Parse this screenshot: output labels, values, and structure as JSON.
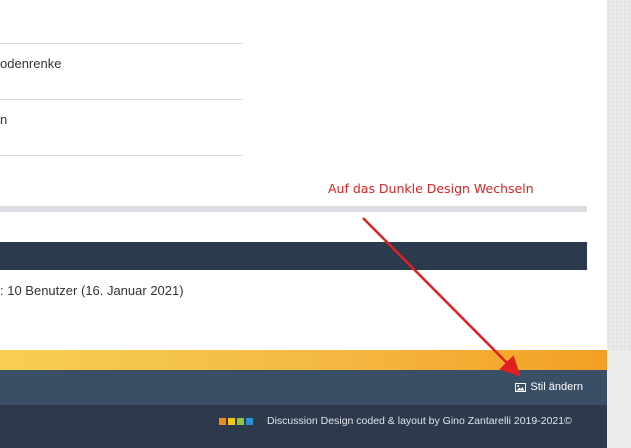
{
  "list": {
    "rows": [
      {
        "text": "odenrenke"
      },
      {
        "text": "n"
      }
    ]
  },
  "annotation": {
    "text": "Auf das Dunkle Design Wechseln",
    "color": "#e02020"
  },
  "stats": {
    "text": ": 10 Benutzer (16. Januar 2021)"
  },
  "style_bar": {
    "label": "Stil ändern",
    "icon": "image-icon"
  },
  "footer": {
    "credit": "Discussion Design coded & layout by Gino Zantarelli 2019-2021©",
    "swatch_colors": [
      "#f08c1a",
      "#f5c518",
      "#8dc63f",
      "#2b8fd6"
    ]
  },
  "colors": {
    "gradient_start": "#f6cf52",
    "gradient_end": "#f3a024",
    "dark_bar": "#2c3a4e",
    "style_bar": "#3a4f66",
    "footer_bg": "#2d3a4b"
  }
}
